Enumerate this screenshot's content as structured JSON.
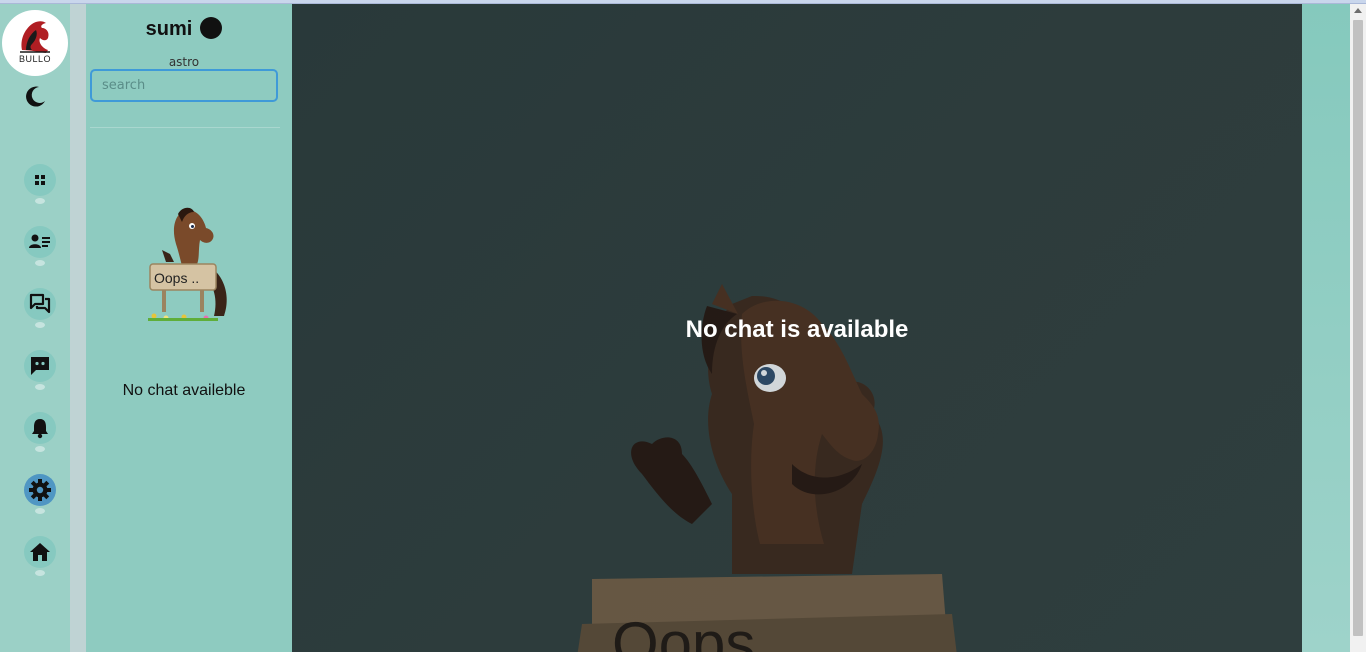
{
  "brand": {
    "logo_text": "BULLO"
  },
  "nav": {
    "items": [
      {
        "name": "dashboard",
        "icon": "grid-icon"
      },
      {
        "name": "contacts",
        "icon": "contact-card-icon"
      },
      {
        "name": "chats",
        "icon": "chat-bubbles-icon"
      },
      {
        "name": "messages",
        "icon": "message-icon"
      },
      {
        "name": "notifications",
        "icon": "bell-icon"
      },
      {
        "name": "settings",
        "icon": "gear-icon",
        "active": true
      },
      {
        "name": "home",
        "icon": "home-icon"
      }
    ]
  },
  "user": {
    "name": "sumi",
    "role": "astro"
  },
  "search": {
    "placeholder": "search",
    "value": ""
  },
  "chat_list": {
    "empty_message": "No chat availeble",
    "illustration_sign": "Oops .."
  },
  "main": {
    "empty_title": "No chat is available",
    "illustration_sign": "Oops"
  },
  "colors": {
    "rail": "#9bd0c6",
    "panel": "#8ecbc0",
    "main_bg": "#2b3b3b",
    "active_nav": "#4f96c3",
    "search_border": "#3f9ad8"
  }
}
